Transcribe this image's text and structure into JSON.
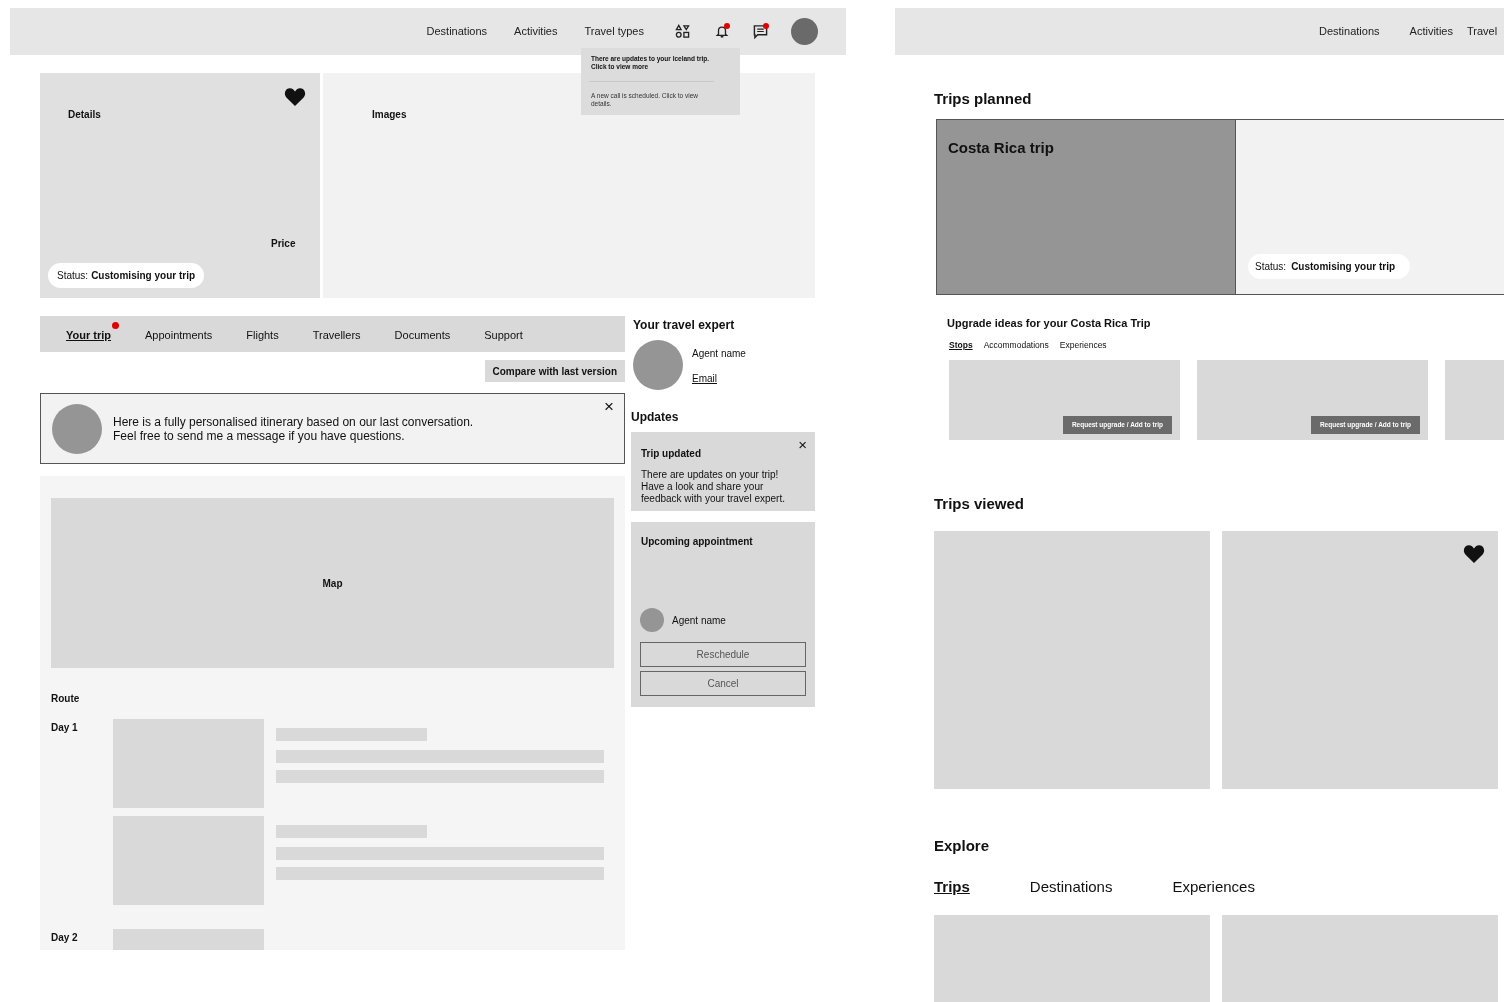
{
  "trip_page": {
    "nav": {
      "links": [
        "Destinations",
        "Activities",
        "Travel types"
      ],
      "icons": [
        {
          "kind": "categories",
          "unread": false
        },
        {
          "kind": "bell",
          "unread": true
        },
        {
          "kind": "chat",
          "unread": true
        }
      ]
    },
    "notifications": [
      {
        "text": "There are updates to your Iceland trip. Click to view more",
        "unread": true
      },
      {
        "text": "A new call is scheduled. Click to view details.",
        "unread": false
      }
    ],
    "details": {
      "label": "Details",
      "price_label": "Price",
      "favorite": true,
      "status_label": "Status:",
      "status": "Customising your trip"
    },
    "images": {
      "label": "Images"
    },
    "tabs": [
      {
        "label": "Your trip",
        "selected": true,
        "unread": true
      },
      {
        "label": "Appointments",
        "selected": false,
        "unread": false
      },
      {
        "label": "Flights",
        "selected": false,
        "unread": false
      },
      {
        "label": "Travellers",
        "selected": false,
        "unread": false
      },
      {
        "label": "Documents",
        "selected": false,
        "unread": false
      },
      {
        "label": "Support",
        "selected": false,
        "unread": false
      }
    ],
    "compare_button": "Compare with last version",
    "message": {
      "lines": [
        "Here is a fully personalised itinerary based on our last conversation.",
        "Feel free to send me a message if you have questions."
      ],
      "close": "×"
    },
    "map": {
      "label": "Map"
    },
    "route": {
      "label": "Route",
      "days": [
        {
          "label": "Day 1",
          "kind": "full"
        },
        {
          "label": "Day 2",
          "kind": "partial"
        }
      ]
    },
    "expert": {
      "heading": "Your travel expert",
      "agent_name": "Agent name",
      "email": "Email"
    },
    "updates": {
      "heading": "Updates",
      "card": {
        "title": "Trip updated",
        "close": "×",
        "lines": [
          "There are updates on your trip!",
          "Have a look and share your",
          "feedback with your travel expert."
        ]
      }
    },
    "appointment": {
      "title": "Upcoming appointment",
      "agent_name": "Agent name",
      "buttons": [
        "Reschedule",
        "Cancel"
      ]
    }
  },
  "dashboard": {
    "nav": {
      "links": [
        "Destinations",
        "Activities",
        "Travel"
      ]
    },
    "trips_planned": {
      "heading": "Trips planned",
      "trip": {
        "name": "Costa Rica trip",
        "status_label": "Status:",
        "status": "Customising your trip"
      }
    },
    "upgrade": {
      "title": "Upgrade ideas for your Costa Rica Trip",
      "tabs": [
        {
          "label": "Stops",
          "selected": true
        },
        {
          "label": "Accommodations",
          "selected": false
        },
        {
          "label": "Experiences",
          "selected": false
        }
      ],
      "cards": [
        {
          "kind": "offer",
          "button": "Request upgrade / Add to trip"
        },
        {
          "kind": "offer",
          "button": "Request upgrade / Add to trip"
        },
        {
          "kind": "partial"
        }
      ]
    },
    "trips_viewed": {
      "heading": "Trips viewed",
      "cards": [
        {
          "favorite": false
        },
        {
          "favorite": true
        }
      ]
    },
    "explore": {
      "heading": "Explore",
      "tabs": [
        {
          "label": "Trips",
          "selected": true
        },
        {
          "label": "Destinations",
          "selected": false
        },
        {
          "label": "Experiences",
          "selected": false
        }
      ]
    }
  }
}
